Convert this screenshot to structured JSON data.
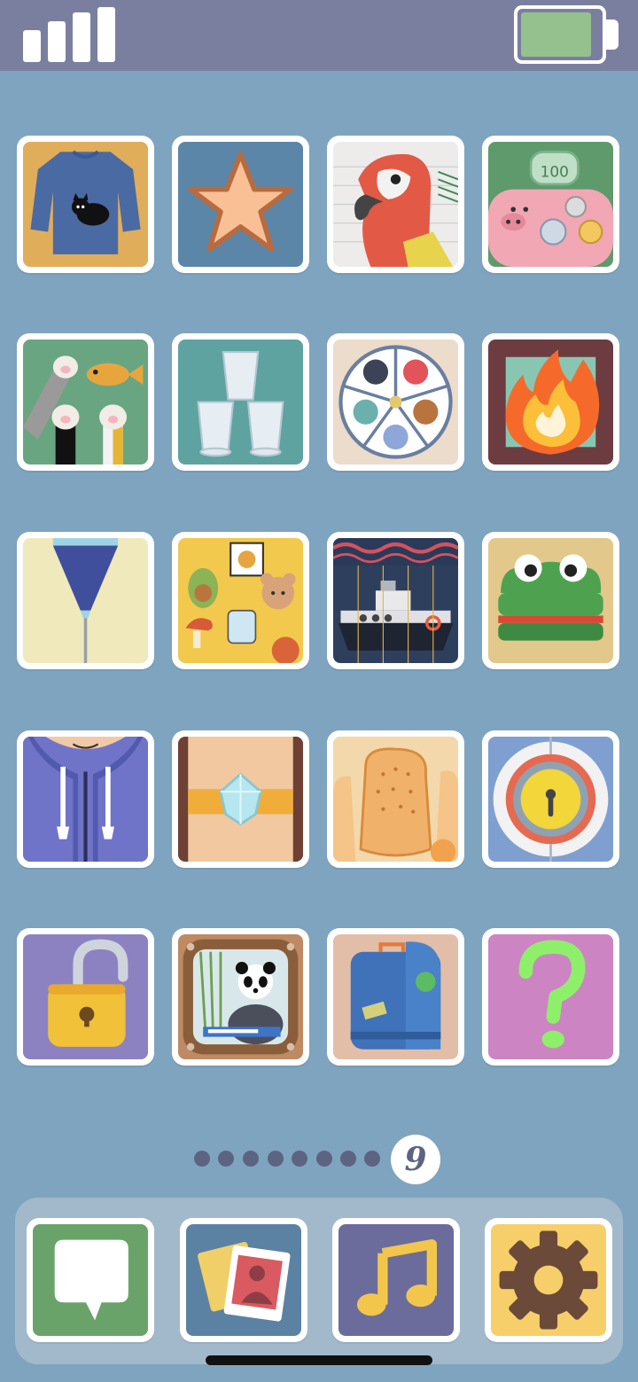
{
  "status_bar": {
    "signal_icon": "cellular-signal-icon",
    "battery_icon": "battery-icon",
    "battery_level_percent": 90,
    "battery_color": "#95c18f"
  },
  "apps": [
    {
      "icon": "sweater-with-cat-icon"
    },
    {
      "icon": "star-icon"
    },
    {
      "icon": "parrot-sketch-icon"
    },
    {
      "icon": "piggy-bank-coins-icon"
    },
    {
      "icon": "cat-paws-and-fish-icon"
    },
    {
      "icon": "stacked-cups-icon"
    },
    {
      "icon": "buttons-tray-icon"
    },
    {
      "icon": "fire-icon"
    },
    {
      "icon": "piping-bag-icon"
    },
    {
      "icon": "stickers-icon"
    },
    {
      "icon": "ship-icon"
    },
    {
      "icon": "crocodile-sandwich-icon"
    },
    {
      "icon": "hoodie-icon"
    },
    {
      "icon": "gem-belt-icon"
    },
    {
      "icon": "crackers-icon"
    },
    {
      "icon": "keyhole-lock-icon"
    },
    {
      "icon": "open-padlock-icon"
    },
    {
      "icon": "panda-tv-icon"
    },
    {
      "icon": "suitcase-icon"
    },
    {
      "icon": "question-mark-icon"
    }
  ],
  "pagination": {
    "current_page": "9"
  },
  "dock": [
    {
      "icon": "messages-icon"
    },
    {
      "icon": "photos-icon"
    },
    {
      "icon": "music-icon"
    },
    {
      "icon": "settings-gear-icon"
    }
  ]
}
